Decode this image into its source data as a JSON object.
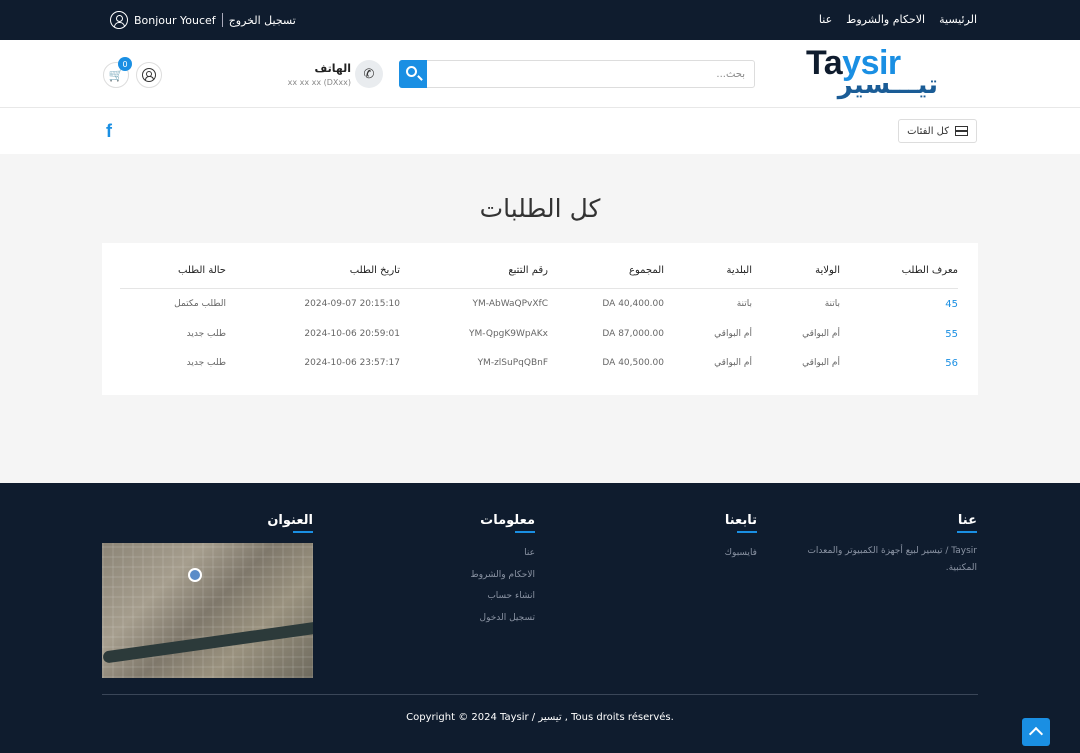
{
  "topbar": {
    "nav": [
      "الرئيسية",
      "الاحكام والشروط",
      "عنا"
    ],
    "logout": "تسجيل الخروج",
    "greeting": "Bonjour Youcef"
  },
  "header": {
    "logo_latin_1": "Ta",
    "logo_latin_2": "ysir",
    "logo_arabic": "تيـــسير",
    "search_placeholder": "بحث...",
    "phone_label": "الهاتف",
    "phone_number": "xx xx xx (DXxx)",
    "cart_count": "0"
  },
  "catbar": {
    "all_categories": "كل الفئات",
    "facebook_glyph": "f"
  },
  "page": {
    "title": "كل الطلبات"
  },
  "orders": {
    "headers": [
      "معرف الطلب",
      "الولاية",
      "البلدية",
      "المجموع",
      "رقم التتبع",
      "تاريخ الطلب",
      "حالة الطلب"
    ],
    "rows": [
      [
        "45",
        "باتنة",
        "باتنة",
        "DA 40,400.00",
        "YM-AbWaQPvXfC",
        "2024-09-07 20:15:10",
        "الطلب مكتمل"
      ],
      [
        "55",
        "أم البواقي",
        "أم البواقي",
        "DA 87,000.00",
        "YM-QpgK9WpAKx",
        "2024-10-06 20:59:01",
        "طلب جديد"
      ],
      [
        "56",
        "أم البواقي",
        "أم البواقي",
        "DA 40,500.00",
        "YM-zlSuPqQBnF",
        "2024-10-06 23:57:17",
        "طلب جديد"
      ]
    ]
  },
  "footer": {
    "about_title": "عنا",
    "about_text": "Taysir / تيسير لبيع أجهزة الكمبيوتر والمعدات المكتبية.",
    "follow_title": "تابعنا",
    "follow_links": [
      "فايسبوك"
    ],
    "info_title": "معلومات",
    "info_links": [
      "عنا",
      "الاحكام والشروط",
      "انشاء حساب",
      "تسجيل الدخول"
    ],
    "address_title": "العنوان",
    "copyright": "Copyright © 2024 Taysir / تيسير , Tous droits réservés."
  },
  "colors": {
    "primary": "#1a8fe3",
    "dark": "#0f1c2e",
    "background": "#f5f5f5"
  }
}
